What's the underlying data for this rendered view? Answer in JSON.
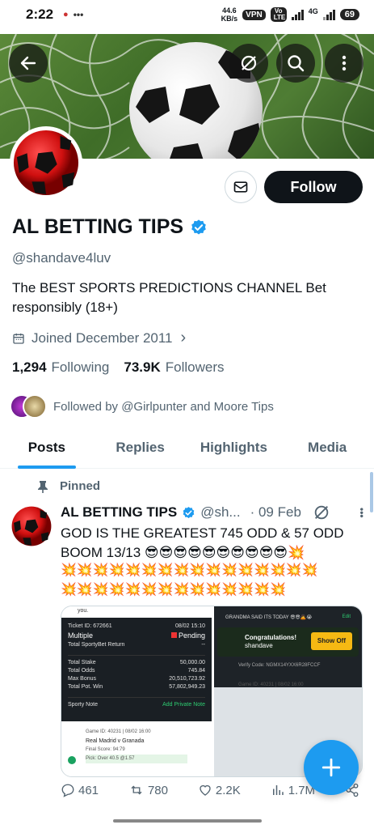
{
  "status_bar": {
    "time": "2:22",
    "speed_value": "44.6",
    "speed_unit": "KB/s",
    "vpn": "VPN",
    "volte": "Vo LTE",
    "network": "4G",
    "battery": "69"
  },
  "header": {
    "back_icon": "arrow-left-icon",
    "icons": [
      "sync-off-icon",
      "search-icon",
      "more-vertical-icon"
    ]
  },
  "profile": {
    "name": "AL BETTING TIPS",
    "handle": "@shandave4luv",
    "bio": "The BEST SPORTS PREDICTIONS CHANNEL Bet responsibly (18+)",
    "joined": "Joined December 2011",
    "following_count": "1,294",
    "following_label": "Following",
    "followers_count": "73.9K",
    "followers_label": "Followers",
    "followed_by": "Followed by @Girlpunter and Moore Tips",
    "follow_label": "Follow"
  },
  "tabs": [
    {
      "label": "Posts",
      "active": true
    },
    {
      "label": "Replies",
      "active": false
    },
    {
      "label": "Highlights",
      "active": false
    },
    {
      "label": "Media",
      "active": false
    }
  ],
  "post": {
    "pinned_label": "Pinned",
    "name": "AL BETTING TIPS",
    "handle": "@sh...",
    "date": "· 09 Feb",
    "text": "GOD IS THE GREATEST 745 ODD & 57 ODD BOOM 13/13 😎😎😎😎😎😎😎😎😎😎💥",
    "emoji_line_1": "💥💥💥💥💥💥💥💥💥💥💥💥💥💥💥💥",
    "emoji_line_2": "💥💥💥💥💥💥💥💥💥💥💥💥💥💥",
    "ticket": {
      "id_label": "Ticket ID: 672661",
      "date": "08/02 15:10",
      "type": "Multiple",
      "status": "Pending",
      "return_label": "Total SportyBet Return",
      "return_value": "--",
      "stake_label": "Total Stake",
      "stake_value": "50,000.00",
      "odds_label": "Total Odds",
      "odds_value": "745.84",
      "bonus_label": "Max Bonus",
      "bonus_value": "20,510,723.92",
      "potwin_label": "Total Pot. Win",
      "potwin_value": "57,802,949.23",
      "note_label": "Sporty Note",
      "private_note": "Add Private Note",
      "game_id": "Game ID: 40231 | 08/02 16:00",
      "match": "Real Madrid v Granada",
      "final_score": "Final Score: 94:79",
      "pick": "Pick: Over 40.5 @1.57",
      "top_text": "you."
    },
    "right_card": {
      "header": "GRANDMA SAID ITS TODAY 😎😎🙇😭",
      "edit": "Edit",
      "congrats": "Congratulations!",
      "user": "shandave",
      "show_off": "Show Off",
      "verify": "Verify Code: NGMX14YXX6R28FCCF",
      "game_id": "Game ID: 40231 | 08/02 16:00"
    },
    "replies": "461",
    "reposts": "780",
    "likes": "2.2K",
    "views": "1.7M"
  },
  "colors": {
    "accent": "#1d9bf0",
    "text": "#0f1419",
    "muted": "#536471"
  }
}
